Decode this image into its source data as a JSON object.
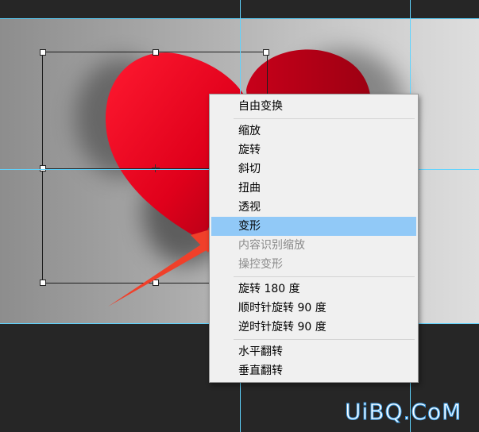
{
  "context_menu": {
    "items": [
      {
        "label": "自由变换",
        "state": "normal"
      },
      {
        "label": "缩放",
        "state": "normal"
      },
      {
        "label": "旋转",
        "state": "normal"
      },
      {
        "label": "斜切",
        "state": "normal"
      },
      {
        "label": "扭曲",
        "state": "normal"
      },
      {
        "label": "透视",
        "state": "normal"
      },
      {
        "label": "变形",
        "state": "highlighted"
      },
      {
        "label": "内容识别缩放",
        "state": "disabled"
      },
      {
        "label": "操控变形",
        "state": "disabled"
      },
      {
        "label": "旋转 180 度",
        "state": "normal"
      },
      {
        "label": "顺时针旋转 90 度",
        "state": "normal"
      },
      {
        "label": "逆时针旋转 90 度",
        "state": "normal"
      },
      {
        "label": "水平翻转",
        "state": "normal"
      },
      {
        "label": "垂直翻转",
        "state": "normal"
      }
    ]
  },
  "canvas": {
    "subject": "heart-image",
    "heart_color": "#e0001b",
    "guide_color": "#5fd4ff",
    "highlight_color": "#91c9f7",
    "arrow_color": "#f0402a"
  },
  "watermark": {
    "text": "UiBQ.CoM"
  }
}
